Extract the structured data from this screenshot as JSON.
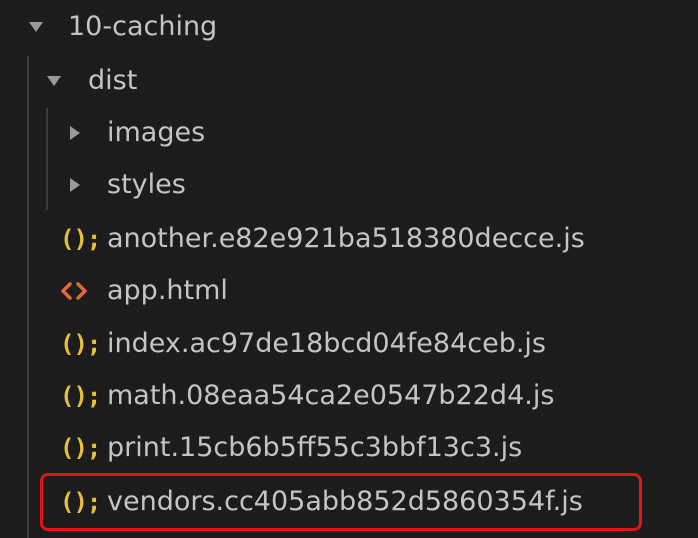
{
  "explorer": {
    "root_folder": {
      "label": "10-caching",
      "expanded": true
    },
    "dist_folder": {
      "label": "dist",
      "expanded": true
    },
    "sub_folders": [
      {
        "label": "images",
        "expanded": false
      },
      {
        "label": "styles",
        "expanded": false
      }
    ],
    "files": [
      {
        "label": "another.e82e921ba518380decce.js",
        "icon": "js-file-icon",
        "icon_glyph": "();"
      },
      {
        "label": "app.html",
        "icon": "html-file-icon",
        "icon_glyph": "<>"
      },
      {
        "label": "index.ac97de18bcd04fe84ceb.js",
        "icon": "js-file-icon",
        "icon_glyph": "();"
      },
      {
        "label": "math.08eaa54ca2e0547b22d4.js",
        "icon": "js-file-icon",
        "icon_glyph": "();"
      },
      {
        "label": "print.15cb6b5ff55c3bbf13c3.js",
        "icon": "js-file-icon",
        "icon_glyph": "();"
      },
      {
        "label": "vendors.cc405abb852d5860354f.js",
        "icon": "js-file-icon",
        "icon_glyph": "();",
        "highlighted": true
      }
    ]
  },
  "colors": {
    "background": "#1c1c1d",
    "text": "#c4c4c6",
    "js_icon": "#e8bf3a",
    "html_icon": "#e8663d",
    "highlight_border": "#e0141b"
  }
}
